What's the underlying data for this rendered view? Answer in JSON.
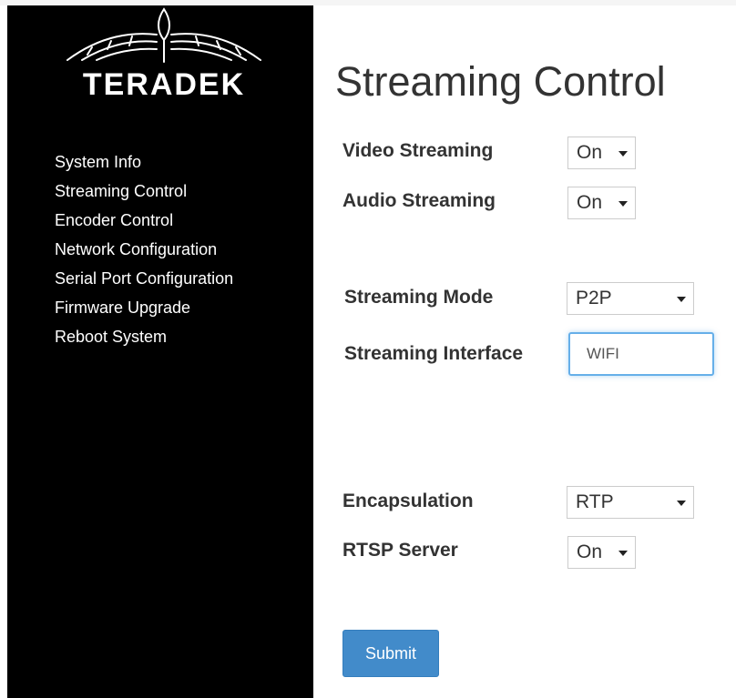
{
  "brand": {
    "logo_text": "TERADEK"
  },
  "sidebar": {
    "items": [
      {
        "label": "System Info"
      },
      {
        "label": "Streaming Control"
      },
      {
        "label": "Encoder Control"
      },
      {
        "label": "Network Configuration"
      },
      {
        "label": "Serial Port Configuration"
      },
      {
        "label": "Firmware Upgrade"
      },
      {
        "label": "Reboot System"
      }
    ]
  },
  "main": {
    "title": "Streaming Control",
    "fields": {
      "video_streaming": {
        "label": "Video Streaming",
        "value": "On"
      },
      "audio_streaming": {
        "label": "Audio Streaming",
        "value": "On"
      },
      "streaming_mode": {
        "label": "Streaming Mode",
        "value": "P2P"
      },
      "streaming_interface": {
        "label": "Streaming Interface",
        "value": "WIFI"
      },
      "encapsulation": {
        "label": "Encapsulation",
        "value": "RTP"
      },
      "rtsp_server": {
        "label": "RTSP Server",
        "value": "On"
      }
    },
    "submit_label": "Submit"
  },
  "colors": {
    "sidebar_bg": "#000000",
    "primary_button": "#428bca",
    "focus_border": "#66afe9"
  }
}
